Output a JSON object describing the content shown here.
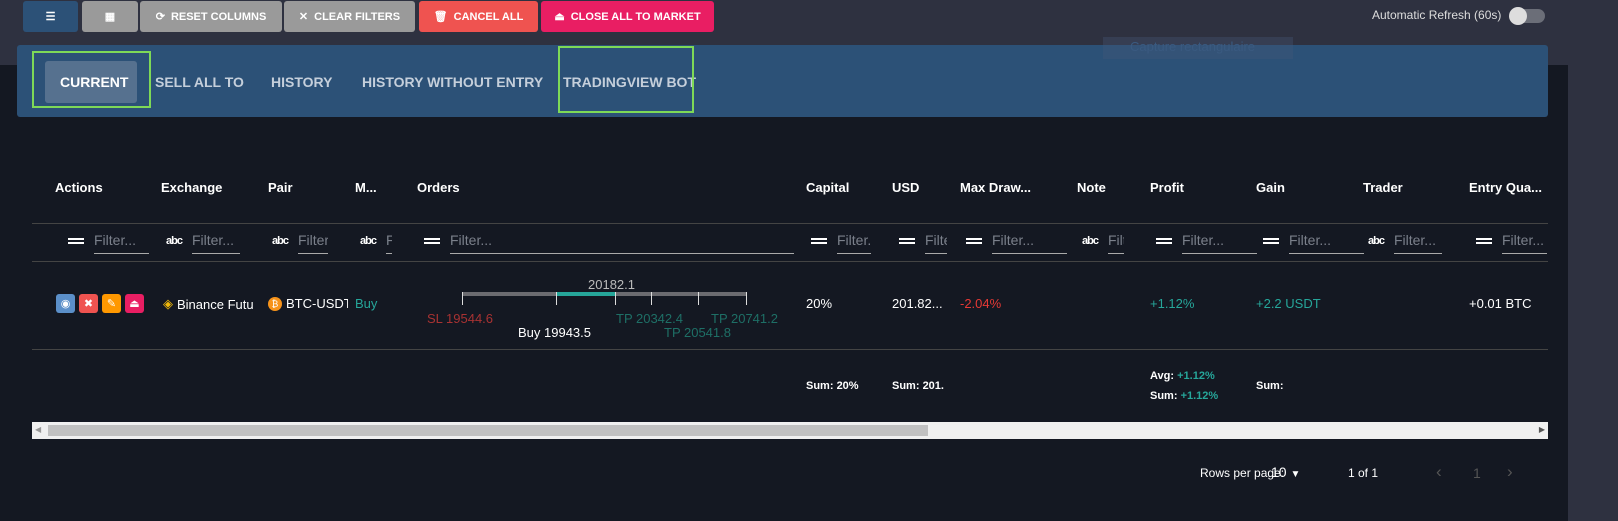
{
  "toolbar": {
    "reset_columns": "RESET COLUMNS",
    "clear_filters": "CLEAR FILTERS",
    "cancel_all": "CANCEL ALL",
    "close_all": "CLOSE ALL TO MARKET",
    "auto_refresh": "Automatic Refresh (60s)"
  },
  "tabs": [
    {
      "label": "CURRENT"
    },
    {
      "label": "SELL ALL TO"
    },
    {
      "label": "HISTORY"
    },
    {
      "label": "HISTORY WITHOUT ENTRY"
    },
    {
      "label": "TRADINGVIEW BOT"
    }
  ],
  "overlay": {
    "capture": "Capture rectangulaire"
  },
  "columns": [
    "Actions",
    "Exchange",
    "Pair",
    "M...",
    "Orders",
    "Capital",
    "USD",
    "Max Draw...",
    "Note",
    "Profit",
    "Gain",
    "Trader",
    "Entry Qua..."
  ],
  "filter_placeholder": "Filter...",
  "row": {
    "exchange": "Binance Futu",
    "pair": "BTC-USDT",
    "mode": "Buy",
    "orders": {
      "current": "20182.1",
      "sl": "SL 19544.6",
      "buy": "Buy 19943.5",
      "tp1": "TP 20342.4",
      "tp2": "TP 20541.8",
      "tp3": "TP 20741.2"
    },
    "capital": "20%",
    "usd": "201.82...",
    "max_draw": "-2.04%",
    "profit": "+1.12%",
    "gain": "+2.2 USDT",
    "entry_qty": "+0.01 BTC"
  },
  "footer": {
    "capital_label": "Sum:",
    "capital_val": "20%",
    "usd_label": "Sum:",
    "usd_val": "201.",
    "profit_avg_label": "Avg:",
    "profit_avg": "+1.12%",
    "profit_sum_label": "Sum:",
    "profit_sum": "+1.12%",
    "gain_label": "Sum:"
  },
  "pagination": {
    "rows_label": "Rows per page:",
    "rows_value": "10",
    "range": "1 of 1",
    "page": "1"
  },
  "colors": {
    "green": "#26a69a",
    "red": "#e53935",
    "tabbar": "#2c5177"
  }
}
